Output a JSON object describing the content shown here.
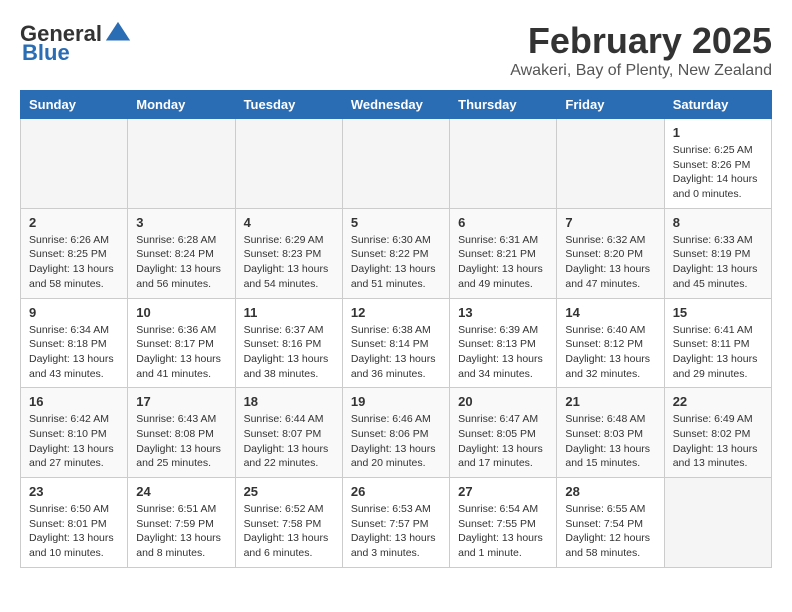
{
  "logo": {
    "general": "General",
    "blue": "Blue"
  },
  "title": {
    "month_year": "February 2025",
    "location": "Awakeri, Bay of Plenty, New Zealand"
  },
  "days_of_week": [
    "Sunday",
    "Monday",
    "Tuesday",
    "Wednesday",
    "Thursday",
    "Friday",
    "Saturday"
  ],
  "weeks": [
    [
      {
        "day": "",
        "info": ""
      },
      {
        "day": "",
        "info": ""
      },
      {
        "day": "",
        "info": ""
      },
      {
        "day": "",
        "info": ""
      },
      {
        "day": "",
        "info": ""
      },
      {
        "day": "",
        "info": ""
      },
      {
        "day": "1",
        "info": "Sunrise: 6:25 AM\nSunset: 8:26 PM\nDaylight: 14 hours\nand 0 minutes."
      }
    ],
    [
      {
        "day": "2",
        "info": "Sunrise: 6:26 AM\nSunset: 8:25 PM\nDaylight: 13 hours\nand 58 minutes."
      },
      {
        "day": "3",
        "info": "Sunrise: 6:28 AM\nSunset: 8:24 PM\nDaylight: 13 hours\nand 56 minutes."
      },
      {
        "day": "4",
        "info": "Sunrise: 6:29 AM\nSunset: 8:23 PM\nDaylight: 13 hours\nand 54 minutes."
      },
      {
        "day": "5",
        "info": "Sunrise: 6:30 AM\nSunset: 8:22 PM\nDaylight: 13 hours\nand 51 minutes."
      },
      {
        "day": "6",
        "info": "Sunrise: 6:31 AM\nSunset: 8:21 PM\nDaylight: 13 hours\nand 49 minutes."
      },
      {
        "day": "7",
        "info": "Sunrise: 6:32 AM\nSunset: 8:20 PM\nDaylight: 13 hours\nand 47 minutes."
      },
      {
        "day": "8",
        "info": "Sunrise: 6:33 AM\nSunset: 8:19 PM\nDaylight: 13 hours\nand 45 minutes."
      }
    ],
    [
      {
        "day": "9",
        "info": "Sunrise: 6:34 AM\nSunset: 8:18 PM\nDaylight: 13 hours\nand 43 minutes."
      },
      {
        "day": "10",
        "info": "Sunrise: 6:36 AM\nSunset: 8:17 PM\nDaylight: 13 hours\nand 41 minutes."
      },
      {
        "day": "11",
        "info": "Sunrise: 6:37 AM\nSunset: 8:16 PM\nDaylight: 13 hours\nand 38 minutes."
      },
      {
        "day": "12",
        "info": "Sunrise: 6:38 AM\nSunset: 8:14 PM\nDaylight: 13 hours\nand 36 minutes."
      },
      {
        "day": "13",
        "info": "Sunrise: 6:39 AM\nSunset: 8:13 PM\nDaylight: 13 hours\nand 34 minutes."
      },
      {
        "day": "14",
        "info": "Sunrise: 6:40 AM\nSunset: 8:12 PM\nDaylight: 13 hours\nand 32 minutes."
      },
      {
        "day": "15",
        "info": "Sunrise: 6:41 AM\nSunset: 8:11 PM\nDaylight: 13 hours\nand 29 minutes."
      }
    ],
    [
      {
        "day": "16",
        "info": "Sunrise: 6:42 AM\nSunset: 8:10 PM\nDaylight: 13 hours\nand 27 minutes."
      },
      {
        "day": "17",
        "info": "Sunrise: 6:43 AM\nSunset: 8:08 PM\nDaylight: 13 hours\nand 25 minutes."
      },
      {
        "day": "18",
        "info": "Sunrise: 6:44 AM\nSunset: 8:07 PM\nDaylight: 13 hours\nand 22 minutes."
      },
      {
        "day": "19",
        "info": "Sunrise: 6:46 AM\nSunset: 8:06 PM\nDaylight: 13 hours\nand 20 minutes."
      },
      {
        "day": "20",
        "info": "Sunrise: 6:47 AM\nSunset: 8:05 PM\nDaylight: 13 hours\nand 17 minutes."
      },
      {
        "day": "21",
        "info": "Sunrise: 6:48 AM\nSunset: 8:03 PM\nDaylight: 13 hours\nand 15 minutes."
      },
      {
        "day": "22",
        "info": "Sunrise: 6:49 AM\nSunset: 8:02 PM\nDaylight: 13 hours\nand 13 minutes."
      }
    ],
    [
      {
        "day": "23",
        "info": "Sunrise: 6:50 AM\nSunset: 8:01 PM\nDaylight: 13 hours\nand 10 minutes."
      },
      {
        "day": "24",
        "info": "Sunrise: 6:51 AM\nSunset: 7:59 PM\nDaylight: 13 hours\nand 8 minutes."
      },
      {
        "day": "25",
        "info": "Sunrise: 6:52 AM\nSunset: 7:58 PM\nDaylight: 13 hours\nand 6 minutes."
      },
      {
        "day": "26",
        "info": "Sunrise: 6:53 AM\nSunset: 7:57 PM\nDaylight: 13 hours\nand 3 minutes."
      },
      {
        "day": "27",
        "info": "Sunrise: 6:54 AM\nSunset: 7:55 PM\nDaylight: 13 hours\nand 1 minute."
      },
      {
        "day": "28",
        "info": "Sunrise: 6:55 AM\nSunset: 7:54 PM\nDaylight: 12 hours\nand 58 minutes."
      },
      {
        "day": "",
        "info": ""
      }
    ]
  ]
}
